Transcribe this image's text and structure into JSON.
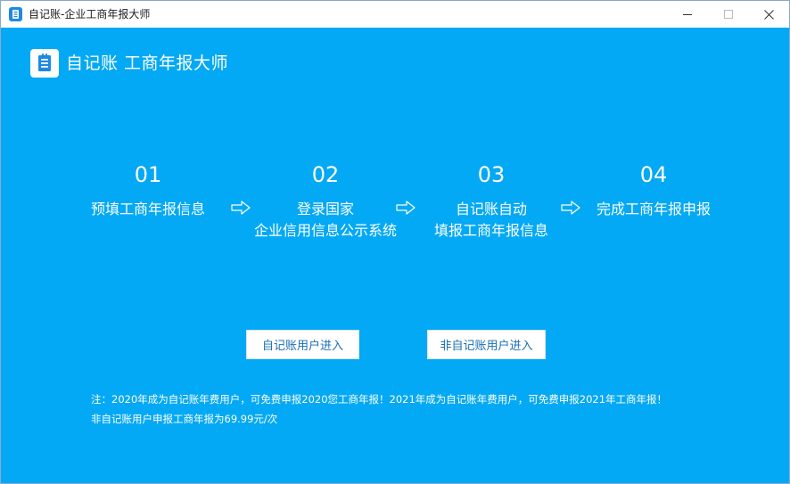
{
  "window": {
    "title": "自记账-企业工商年报大师",
    "controls": {
      "minimize": "minimize-icon",
      "maximize": "maximize-icon",
      "close": "close-icon"
    }
  },
  "header": {
    "app_name": "自记账 工商年报大师",
    "logo_icon": "notebook-icon"
  },
  "steps": [
    {
      "num": "01",
      "lines": [
        "预填工商年报信息"
      ]
    },
    {
      "num": "02",
      "lines": [
        "登录国家",
        "企业信用信息公示系统"
      ]
    },
    {
      "num": "03",
      "lines": [
        "自记账自动",
        "填报工商年报信息"
      ]
    },
    {
      "num": "04",
      "lines": [
        "完成工商年报申报"
      ]
    }
  ],
  "actions": {
    "user_enter": "自记账用户进入",
    "nonuser_enter": "非自记账用户进入"
  },
  "notes": {
    "line1": "注：2020年成为自记账年费用户，可免费申报2020您工商年报！2021年成为自记账年费用户，可免费申报2021年工商年报！",
    "line2": "非自记账用户申报工商年报为69.99元/次"
  },
  "colors": {
    "background": "#03a9f4",
    "titlebar": "#ffffff",
    "button_text": "#1a6fb5"
  }
}
